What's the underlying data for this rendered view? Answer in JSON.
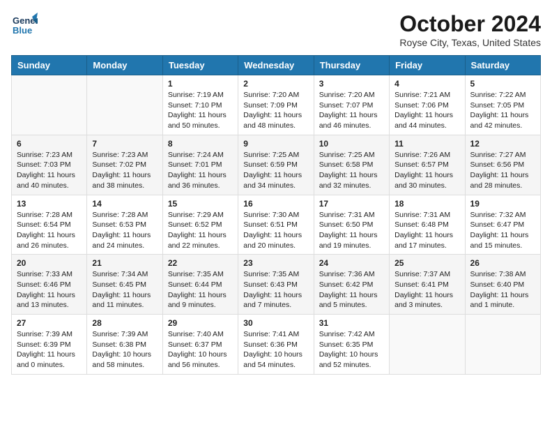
{
  "header": {
    "logo_line1": "General",
    "logo_line2": "Blue",
    "title": "October 2024",
    "subtitle": "Royse City, Texas, United States"
  },
  "columns": [
    "Sunday",
    "Monday",
    "Tuesday",
    "Wednesday",
    "Thursday",
    "Friday",
    "Saturday"
  ],
  "weeks": [
    [
      {
        "day": "",
        "sunrise": "",
        "sunset": "",
        "daylight": ""
      },
      {
        "day": "",
        "sunrise": "",
        "sunset": "",
        "daylight": ""
      },
      {
        "day": "1",
        "sunrise": "Sunrise: 7:19 AM",
        "sunset": "Sunset: 7:10 PM",
        "daylight": "Daylight: 11 hours and 50 minutes."
      },
      {
        "day": "2",
        "sunrise": "Sunrise: 7:20 AM",
        "sunset": "Sunset: 7:09 PM",
        "daylight": "Daylight: 11 hours and 48 minutes."
      },
      {
        "day": "3",
        "sunrise": "Sunrise: 7:20 AM",
        "sunset": "Sunset: 7:07 PM",
        "daylight": "Daylight: 11 hours and 46 minutes."
      },
      {
        "day": "4",
        "sunrise": "Sunrise: 7:21 AM",
        "sunset": "Sunset: 7:06 PM",
        "daylight": "Daylight: 11 hours and 44 minutes."
      },
      {
        "day": "5",
        "sunrise": "Sunrise: 7:22 AM",
        "sunset": "Sunset: 7:05 PM",
        "daylight": "Daylight: 11 hours and 42 minutes."
      }
    ],
    [
      {
        "day": "6",
        "sunrise": "Sunrise: 7:23 AM",
        "sunset": "Sunset: 7:03 PM",
        "daylight": "Daylight: 11 hours and 40 minutes."
      },
      {
        "day": "7",
        "sunrise": "Sunrise: 7:23 AM",
        "sunset": "Sunset: 7:02 PM",
        "daylight": "Daylight: 11 hours and 38 minutes."
      },
      {
        "day": "8",
        "sunrise": "Sunrise: 7:24 AM",
        "sunset": "Sunset: 7:01 PM",
        "daylight": "Daylight: 11 hours and 36 minutes."
      },
      {
        "day": "9",
        "sunrise": "Sunrise: 7:25 AM",
        "sunset": "Sunset: 6:59 PM",
        "daylight": "Daylight: 11 hours and 34 minutes."
      },
      {
        "day": "10",
        "sunrise": "Sunrise: 7:25 AM",
        "sunset": "Sunset: 6:58 PM",
        "daylight": "Daylight: 11 hours and 32 minutes."
      },
      {
        "day": "11",
        "sunrise": "Sunrise: 7:26 AM",
        "sunset": "Sunset: 6:57 PM",
        "daylight": "Daylight: 11 hours and 30 minutes."
      },
      {
        "day": "12",
        "sunrise": "Sunrise: 7:27 AM",
        "sunset": "Sunset: 6:56 PM",
        "daylight": "Daylight: 11 hours and 28 minutes."
      }
    ],
    [
      {
        "day": "13",
        "sunrise": "Sunrise: 7:28 AM",
        "sunset": "Sunset: 6:54 PM",
        "daylight": "Daylight: 11 hours and 26 minutes."
      },
      {
        "day": "14",
        "sunrise": "Sunrise: 7:28 AM",
        "sunset": "Sunset: 6:53 PM",
        "daylight": "Daylight: 11 hours and 24 minutes."
      },
      {
        "day": "15",
        "sunrise": "Sunrise: 7:29 AM",
        "sunset": "Sunset: 6:52 PM",
        "daylight": "Daylight: 11 hours and 22 minutes."
      },
      {
        "day": "16",
        "sunrise": "Sunrise: 7:30 AM",
        "sunset": "Sunset: 6:51 PM",
        "daylight": "Daylight: 11 hours and 20 minutes."
      },
      {
        "day": "17",
        "sunrise": "Sunrise: 7:31 AM",
        "sunset": "Sunset: 6:50 PM",
        "daylight": "Daylight: 11 hours and 19 minutes."
      },
      {
        "day": "18",
        "sunrise": "Sunrise: 7:31 AM",
        "sunset": "Sunset: 6:48 PM",
        "daylight": "Daylight: 11 hours and 17 minutes."
      },
      {
        "day": "19",
        "sunrise": "Sunrise: 7:32 AM",
        "sunset": "Sunset: 6:47 PM",
        "daylight": "Daylight: 11 hours and 15 minutes."
      }
    ],
    [
      {
        "day": "20",
        "sunrise": "Sunrise: 7:33 AM",
        "sunset": "Sunset: 6:46 PM",
        "daylight": "Daylight: 11 hours and 13 minutes."
      },
      {
        "day": "21",
        "sunrise": "Sunrise: 7:34 AM",
        "sunset": "Sunset: 6:45 PM",
        "daylight": "Daylight: 11 hours and 11 minutes."
      },
      {
        "day": "22",
        "sunrise": "Sunrise: 7:35 AM",
        "sunset": "Sunset: 6:44 PM",
        "daylight": "Daylight: 11 hours and 9 minutes."
      },
      {
        "day": "23",
        "sunrise": "Sunrise: 7:35 AM",
        "sunset": "Sunset: 6:43 PM",
        "daylight": "Daylight: 11 hours and 7 minutes."
      },
      {
        "day": "24",
        "sunrise": "Sunrise: 7:36 AM",
        "sunset": "Sunset: 6:42 PM",
        "daylight": "Daylight: 11 hours and 5 minutes."
      },
      {
        "day": "25",
        "sunrise": "Sunrise: 7:37 AM",
        "sunset": "Sunset: 6:41 PM",
        "daylight": "Daylight: 11 hours and 3 minutes."
      },
      {
        "day": "26",
        "sunrise": "Sunrise: 7:38 AM",
        "sunset": "Sunset: 6:40 PM",
        "daylight": "Daylight: 11 hours and 1 minute."
      }
    ],
    [
      {
        "day": "27",
        "sunrise": "Sunrise: 7:39 AM",
        "sunset": "Sunset: 6:39 PM",
        "daylight": "Daylight: 11 hours and 0 minutes."
      },
      {
        "day": "28",
        "sunrise": "Sunrise: 7:39 AM",
        "sunset": "Sunset: 6:38 PM",
        "daylight": "Daylight: 10 hours and 58 minutes."
      },
      {
        "day": "29",
        "sunrise": "Sunrise: 7:40 AM",
        "sunset": "Sunset: 6:37 PM",
        "daylight": "Daylight: 10 hours and 56 minutes."
      },
      {
        "day": "30",
        "sunrise": "Sunrise: 7:41 AM",
        "sunset": "Sunset: 6:36 PM",
        "daylight": "Daylight: 10 hours and 54 minutes."
      },
      {
        "day": "31",
        "sunrise": "Sunrise: 7:42 AM",
        "sunset": "Sunset: 6:35 PM",
        "daylight": "Daylight: 10 hours and 52 minutes."
      },
      {
        "day": "",
        "sunrise": "",
        "sunset": "",
        "daylight": ""
      },
      {
        "day": "",
        "sunrise": "",
        "sunset": "",
        "daylight": ""
      }
    ]
  ]
}
